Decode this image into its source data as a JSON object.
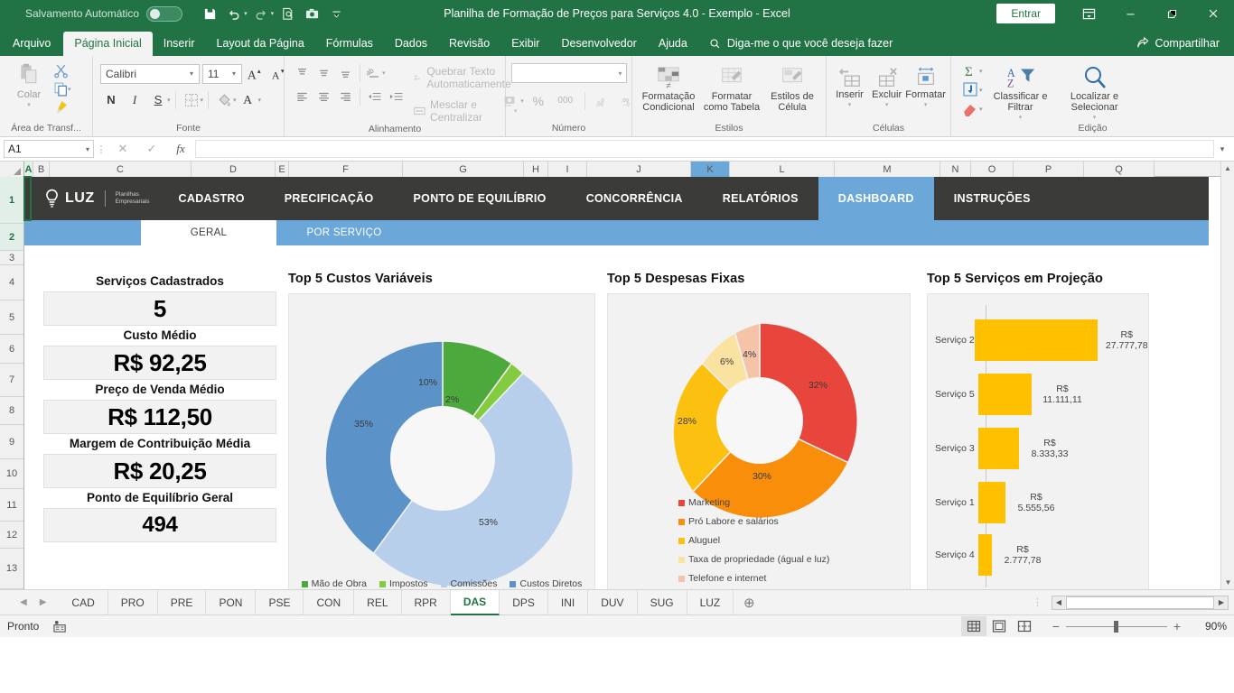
{
  "titlebar": {
    "autosave_label": "Salvamento Automático",
    "autosave_state": "off",
    "document_title": "Planilha de Formação de Preços para Serviços 4.0 - Exemplo  -  Excel",
    "signin_label": "Entrar",
    "qat_icons": [
      "save-icon",
      "undo-icon",
      "redo-icon",
      "print-preview-icon",
      "camera-icon",
      "customize-qat-icon"
    ],
    "window_icons": [
      "ribbon-display-options-icon",
      "minimize-icon",
      "restore-icon",
      "close-icon"
    ]
  },
  "ribbon": {
    "tabs": [
      {
        "label": "Arquivo",
        "active": false
      },
      {
        "label": "Página Inicial",
        "active": true
      },
      {
        "label": "Inserir",
        "active": false
      },
      {
        "label": "Layout da Página",
        "active": false
      },
      {
        "label": "Fórmulas",
        "active": false
      },
      {
        "label": "Dados",
        "active": false
      },
      {
        "label": "Revisão",
        "active": false
      },
      {
        "label": "Exibir",
        "active": false
      },
      {
        "label": "Desenvolvedor",
        "active": false
      },
      {
        "label": "Ajuda",
        "active": false
      }
    ],
    "tellme_placeholder": "Diga-me o que você deseja fazer",
    "share_label": "Compartilhar",
    "groups": {
      "clipboard": {
        "label": "Área de Transf...",
        "paste_label": "Colar",
        "cut_label": "cut-icon",
        "copy_label": "copy-icon",
        "format_painter_label": "format-painter-icon"
      },
      "font": {
        "label": "Fonte",
        "font_family": "Calibri",
        "font_size": "11",
        "bold": "N",
        "italic": "I",
        "underline": "S"
      },
      "alignment": {
        "label": "Alinhamento",
        "wrap_text": "Quebrar Texto Automaticamente",
        "merge_center": "Mesclar e Centralizar"
      },
      "number": {
        "label": "Número",
        "format_value": "",
        "percent": "%",
        "thousands": "000"
      },
      "styles": {
        "label": "Estilos",
        "conditional": "Formatação Condicional",
        "as_table": "Formatar como Tabela",
        "cell_styles": "Estilos de Célula"
      },
      "cells": {
        "label": "Células",
        "insert": "Inserir",
        "delete": "Excluir",
        "format": "Formatar"
      },
      "editing": {
        "label": "Edição",
        "sort_filter": "Classificar e Filtrar",
        "find_select": "Localizar e Selecionar"
      }
    }
  },
  "formulabar": {
    "name_box": "A1",
    "cancel_icon": "cancel-icon",
    "confirm_icon": "confirm-icon",
    "fx_icon": "fx-icon",
    "formula_value": ""
  },
  "grid": {
    "columns": [
      "A",
      "B",
      "C",
      "D",
      "E",
      "F",
      "G",
      "H",
      "I",
      "J",
      "K",
      "L",
      "M",
      "N",
      "O",
      "P",
      "Q"
    ],
    "rows": [
      "1",
      "2",
      "3",
      "4",
      "5",
      "6",
      "7",
      "8",
      "9",
      "10",
      "11",
      "12",
      "13"
    ],
    "selected_cell": "A1"
  },
  "dashboard": {
    "brand": {
      "name": "LUZ",
      "tagline_line1": "Planilhas",
      "tagline_line2": "Empresariais"
    },
    "nav_items": [
      {
        "label": "CADASTRO",
        "active": false
      },
      {
        "label": "PRECIFICAÇÃO",
        "active": false
      },
      {
        "label": "PONTO DE EQUILÍBRIO",
        "active": false
      },
      {
        "label": "CONCORRÊNCIA",
        "active": false
      },
      {
        "label": "RELATÓRIOS",
        "active": false
      },
      {
        "label": "DASHBOARD",
        "active": true
      },
      {
        "label": "INSTRUÇÕES",
        "active": false
      }
    ],
    "sub_tabs": [
      {
        "label": "GERAL",
        "active": true
      },
      {
        "label": "POR SERVIÇO",
        "active": false
      }
    ],
    "kpis": [
      {
        "label": "Serviços Cadastrados",
        "value": "5"
      },
      {
        "label": "Custo Médio",
        "value": "R$ 92,25"
      },
      {
        "label": "Preço de Venda Médio",
        "value": "R$ 112,50"
      },
      {
        "label": "Margem de Contribuição Média",
        "value": "R$ 20,25"
      },
      {
        "label": "Ponto de Equilíbrio Geral",
        "value": "494"
      }
    ]
  },
  "chart_data": [
    {
      "type": "pie",
      "title": "Top 5 Custos Variáveis",
      "variant": "donut",
      "legend_position": "bottom",
      "categories": [
        "Mão de Obra",
        "Impostos",
        "Comissões",
        "Custos Diretos"
      ],
      "values": [
        10,
        2,
        53,
        35
      ],
      "data_labels": [
        "10%",
        "2%",
        "53%",
        "35%"
      ],
      "colors": [
        "#4ca93c",
        "#83cc3f",
        "#b7cfea",
        "#5b93c8"
      ]
    },
    {
      "type": "pie",
      "title": "Top 5 Despesas Fixas",
      "variant": "donut",
      "legend_position": "bottom-left",
      "categories": [
        "Marketing",
        "Pró Labore e salários",
        "Aluguel",
        "Taxa de propriedade (águal e luz)",
        "Telefone e internet"
      ],
      "values": [
        32,
        30,
        28,
        6,
        4
      ],
      "data_labels": [
        "32%",
        "30%",
        "28%",
        "6%",
        "4%"
      ],
      "colors": [
        "#e8453c",
        "#f98e0b",
        "#fcc010",
        "#fae3a0",
        "#f4c3a8"
      ]
    },
    {
      "type": "bar",
      "orientation": "horizontal",
      "title": "Top 5 Serviços em Projeção",
      "categories": [
        "Serviço 2",
        "Serviço 5",
        "Serviço 3",
        "Serviço 1",
        "Serviço 4"
      ],
      "values": [
        27777.78,
        11111.11,
        8333.33,
        5555.56,
        2777.78
      ],
      "data_labels": [
        "R$ 27.777,78",
        "R$ 11.111,11",
        "R$ 8.333,33",
        "R$ 5.555,56",
        "R$ 2.777,78"
      ],
      "bar_color": "#ffc000",
      "xlabel": "",
      "ylabel": "",
      "grid": false
    }
  ],
  "sheet_tabs": [
    {
      "label": "CAD",
      "active": false
    },
    {
      "label": "PRO",
      "active": false
    },
    {
      "label": "PRE",
      "active": false
    },
    {
      "label": "PON",
      "active": false
    },
    {
      "label": "PSE",
      "active": false
    },
    {
      "label": "CON",
      "active": false
    },
    {
      "label": "REL",
      "active": false
    },
    {
      "label": "RPR",
      "active": false
    },
    {
      "label": "DAS",
      "active": true
    },
    {
      "label": "DPS",
      "active": false
    },
    {
      "label": "INI",
      "active": false
    },
    {
      "label": "DUV",
      "active": false
    },
    {
      "label": "SUG",
      "active": false
    },
    {
      "label": "LUZ",
      "active": false
    }
  ],
  "statusbar": {
    "status": "Pronto",
    "zoom": "90%",
    "views": [
      "normal-view-icon",
      "page-layout-icon",
      "page-break-preview-icon"
    ]
  }
}
